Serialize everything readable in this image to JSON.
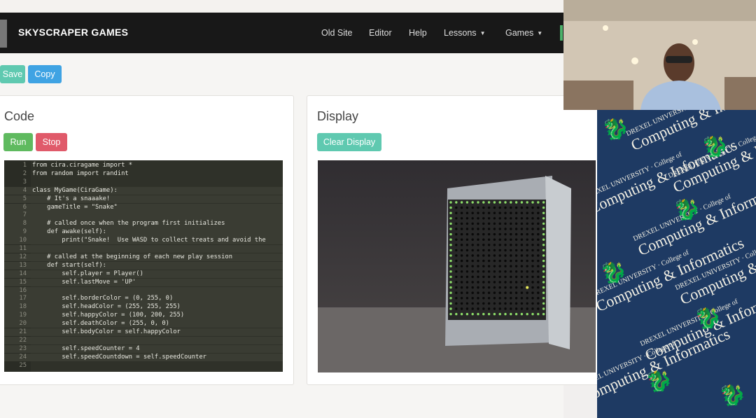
{
  "navbar": {
    "brand": "SKYSCRAPER GAMES",
    "items": [
      "Old Site",
      "Editor",
      "Help",
      "Lessons",
      "Games"
    ]
  },
  "toolbar": {
    "save_label": "Save",
    "copy_label": "Copy"
  },
  "code_panel": {
    "title": "Code",
    "run_label": "Run",
    "stop_label": "Stop",
    "lines": [
      "from cira.ciragame import *",
      "from random import randint",
      "",
      "class MyGame(CiraGame):",
      "    # It's a snaaake!",
      "    gameTitle = \"Snake\"",
      "",
      "    # called once when the program first initializes",
      "    def awake(self):",
      "        print(\"Snake!  Use WASD to collect treats and avoid the",
      "",
      "    # called at the beginning of each new play session",
      "    def start(self):",
      "        self.player = Player()",
      "        self.lastMove = 'UP'",
      "",
      "        self.borderColor = (0, 255, 0)",
      "        self.headColor = (255, 255, 255)",
      "        self.happyColor = (100, 200, 255)",
      "        self.deathColor = (255, 0, 0)",
      "        self.bodyColor = self.happyColor",
      "",
      "        self.speedCounter = 4",
      "        self.speedCountdown = self.speedCounter",
      ""
    ]
  },
  "display_panel": {
    "title": "Display",
    "clear_label": "Clear Display"
  },
  "banner": {
    "university": "DREXEL UNIVERSITY",
    "college": "College of",
    "name": "Computing & Informatics"
  },
  "colors": {
    "navbar": "#181818",
    "save": "#5fc9b0",
    "copy": "#3fa3e3",
    "run": "#5fba5f",
    "stop": "#e05a6a",
    "banner": "#1e3a63",
    "dragon": "#f6c84a"
  }
}
